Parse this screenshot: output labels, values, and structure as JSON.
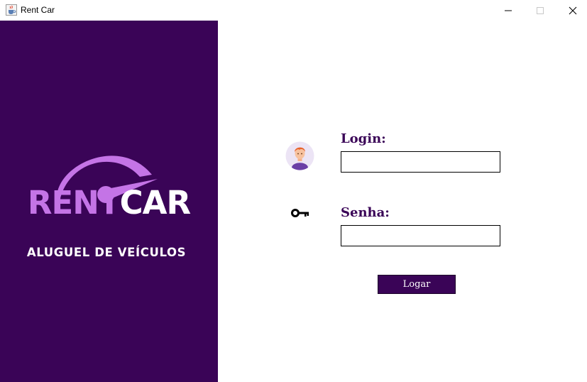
{
  "window": {
    "title": "Rent Car",
    "app_icon": "java-cup-icon",
    "controls": [
      "minimize-icon",
      "maximize-icon",
      "close-icon"
    ]
  },
  "brand": {
    "logo_icon": "speedometer-icon",
    "name_part1": "RENT",
    "name_part2": "CAR",
    "tagline": "ALUGUEL DE VEÍCULOS",
    "colors": {
      "panel": "#3a0457",
      "accent": "#c474e6",
      "text": "#ffffff"
    }
  },
  "form": {
    "login_icon": "user-avatar-icon",
    "login_label": "Login:",
    "login_value": "",
    "password_icon": "key-icon",
    "password_label": "Senha:",
    "password_value": "",
    "submit_label": "Logar",
    "colors": {
      "label": "#3a0457",
      "button_bg": "#3a0457",
      "button_text": "#ffffff"
    }
  }
}
